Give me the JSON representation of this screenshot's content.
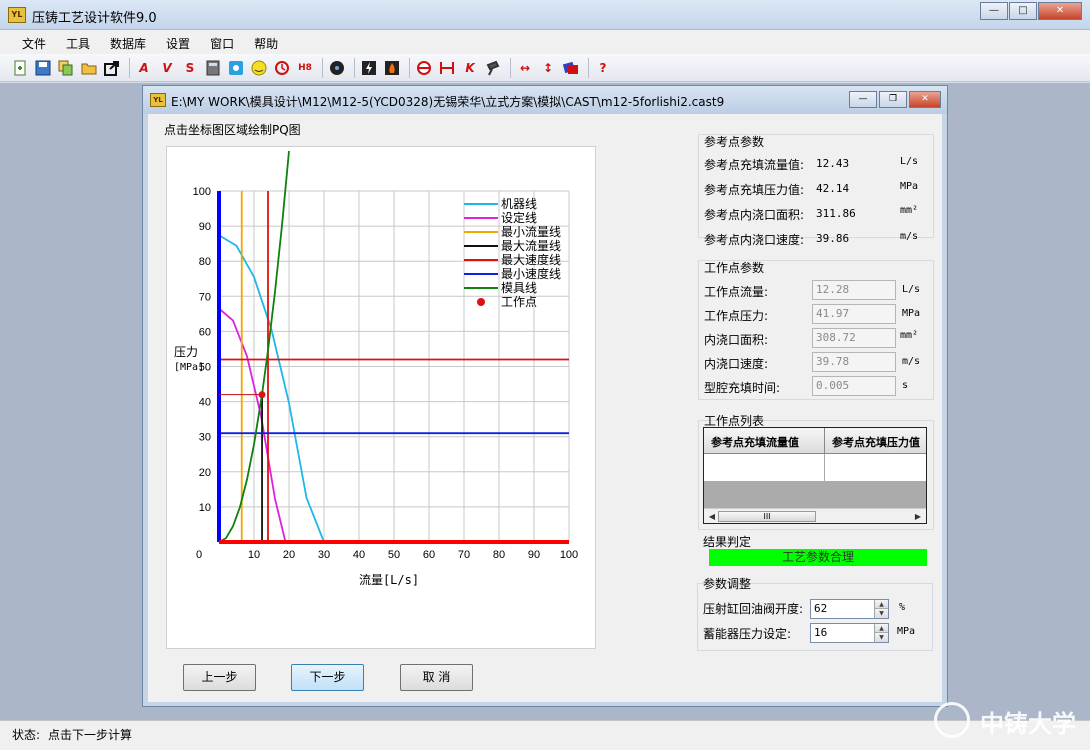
{
  "app": {
    "title": "压铸工艺设计软件9.0",
    "icon_text": "YL"
  },
  "menu": [
    "文件",
    "工具",
    "数据库",
    "设置",
    "窗口",
    "帮助"
  ],
  "toolbar": [
    "new-icon",
    "save-icon",
    "copy-icon",
    "open-icon",
    "export-icon",
    "A-icon",
    "V-icon",
    "S-icon",
    "calculator-icon",
    "calendar-icon",
    "smiley-icon",
    "clock-icon",
    "H8-icon",
    "film-icon",
    "lightning-icon",
    "flame-icon",
    "circle-half-icon",
    "width-icon",
    "K-icon",
    "pin-icon",
    "horizontal-arrow-icon",
    "vertical-arrow-icon",
    "stack-icon",
    "help-icon"
  ],
  "toolbar_text": {
    "h8": "H8",
    "k": "K",
    "help": "?"
  },
  "child": {
    "title": "E:\\MY WORK\\模具设计\\M12\\M12-5(YCD0328)无锡荣华\\立式方案\\模拟\\CAST\\m12-5forlishi2.cast9",
    "chart_caption": "点击坐标图区域绘制PQ图"
  },
  "chart_data": {
    "type": "line",
    "xlabel": "流量[L/s]",
    "ylabel": "压力 [MPa]",
    "ylabel_lines": [
      "压力",
      "[MPa]"
    ],
    "xlim": [
      0,
      100
    ],
    "ylim": [
      0,
      100
    ],
    "xticks": [
      0,
      10,
      20,
      30,
      40,
      50,
      60,
      70,
      80,
      90,
      100
    ],
    "yticks": [
      0,
      10,
      20,
      30,
      40,
      50,
      60,
      70,
      80,
      90,
      100
    ],
    "grid": true,
    "legend_position": "top-right",
    "series": [
      {
        "name": "机器线",
        "color": "#1fb6e8",
        "x": [
          0,
          5,
          10,
          15,
          20,
          25,
          30,
          33.5
        ],
        "y": [
          87.4,
          84.4,
          75.5,
          60.5,
          39.6,
          12.6,
          0,
          0
        ]
      },
      {
        "name": "设定线",
        "color": "#e020e0",
        "x": [
          0,
          4,
          8,
          12,
          16,
          19,
          21
        ],
        "y": [
          66.5,
          63.1,
          52.9,
          36.0,
          12.3,
          0,
          0
        ]
      },
      {
        "name": "最小流量线",
        "color": "#f0a800",
        "x": [
          6.5,
          6.5
        ],
        "y": [
          0,
          100
        ]
      },
      {
        "name": "最大流量线",
        "color": "#101010",
        "x": [
          12.3,
          12.3
        ],
        "y": [
          0,
          42
        ]
      },
      {
        "name": "最大速度线",
        "color": "#e01010",
        "x": [
          14,
          14
        ],
        "y": [
          0,
          100
        ]
      },
      {
        "name": "最大速度线",
        "color": "#e01010",
        "x": [
          0,
          100
        ],
        "y": [
          52,
          52
        ]
      },
      {
        "name": "最小速度线",
        "color": "#1020e0",
        "x": [
          0,
          100
        ],
        "y": [
          31,
          31
        ]
      },
      {
        "name": "模具线",
        "color": "#108010",
        "x": [
          0,
          2,
          4,
          6,
          8,
          10,
          12.28,
          14,
          16,
          18,
          20
        ],
        "y": [
          0,
          1.1,
          4.5,
          10.0,
          17.8,
          27.8,
          41.97,
          54.6,
          71.3,
          90.2,
          111.4
        ]
      },
      {
        "name": "工作点",
        "color": "#e01010",
        "x": [
          12.28
        ],
        "y": [
          41.97
        ]
      }
    ],
    "legend": [
      {
        "name": "机器线",
        "color": "#1fb6e8",
        "kind": "line"
      },
      {
        "name": "设定线",
        "color": "#e020e0",
        "kind": "line"
      },
      {
        "name": "最小流量线",
        "color": "#f0a800",
        "kind": "line"
      },
      {
        "name": "最大流量线",
        "color": "#101010",
        "kind": "line"
      },
      {
        "name": "最大速度线",
        "color": "#e01010",
        "kind": "line"
      },
      {
        "name": "最小速度线",
        "color": "#1020e0",
        "kind": "line"
      },
      {
        "name": "模具线",
        "color": "#108010",
        "kind": "line"
      },
      {
        "name": "工作点",
        "color": "#e01010",
        "kind": "dot"
      }
    ]
  },
  "ref_params": {
    "title": "参考点参数",
    "rows": [
      {
        "label": "参考点充填流量值:",
        "value": "12.43",
        "unit": "L/s"
      },
      {
        "label": "参考点充填压力值:",
        "value": "42.14",
        "unit": "MPa"
      },
      {
        "label": "参考点内浇口面积:",
        "value": "311.86",
        "unit": "mm²"
      },
      {
        "label": "参考点内浇口速度:",
        "value": "39.86",
        "unit": "m/s"
      }
    ]
  },
  "work_params": {
    "title": "工作点参数",
    "rows": [
      {
        "label": "工作点流量:",
        "value": "12.28",
        "unit": "L/s"
      },
      {
        "label": "工作点压力:",
        "value": "41.97",
        "unit": "MPa"
      },
      {
        "label": "内浇口面积:",
        "value": "308.72",
        "unit": "mm²"
      },
      {
        "label": "内浇口速度:",
        "value": "39.78",
        "unit": "m/s"
      },
      {
        "label": "型腔充填时间:",
        "value": "0.005",
        "unit": "s"
      }
    ]
  },
  "work_list": {
    "title": "工作点列表",
    "columns": [
      "参考点充填流量值",
      "参考点充填压力值"
    ],
    "scroll_grip": "III"
  },
  "result": {
    "title": "结果判定",
    "value": "工艺参数合理",
    "color": "#00ff00"
  },
  "adjust": {
    "title": "参数调整",
    "rows": [
      {
        "label": "压射缸回油阀开度:",
        "value": "62",
        "unit": "%"
      },
      {
        "label": "蓄能器压力设定:",
        "value": "16",
        "unit": "MPa"
      }
    ]
  },
  "buttons": {
    "prev": "上一步",
    "next": "下一步",
    "cancel": "取 消"
  },
  "status": {
    "label": "状态:",
    "text": "点击下一步计算"
  },
  "watermark": "中铸大学"
}
